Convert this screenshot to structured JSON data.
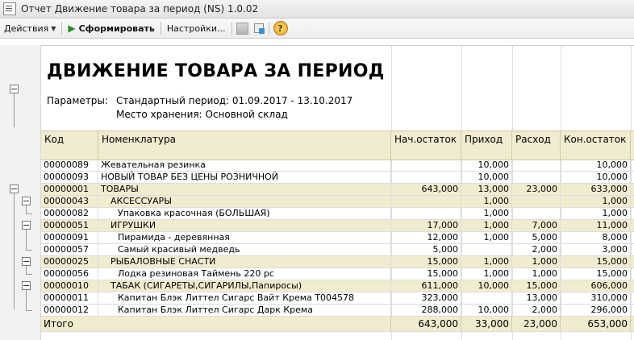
{
  "window": {
    "title": "Отчет  Движение товара за период (NS) 1.0.02"
  },
  "toolbar": {
    "actions_label": "Действия",
    "generate_label": "Сформировать",
    "settings_label": "Настройки...",
    "help_label": "?"
  },
  "report": {
    "title": "ДВИЖЕНИЕ ТОВАРА ЗА ПЕРИОД",
    "params_label": "Параметры:",
    "period": "Стандартный период: 01.09.2017 - 13.10.2017",
    "storage": "Место хранения: Основной склад",
    "columns": [
      "Код",
      "Номенклатура",
      "Нач.остаток",
      "Приход",
      "Расход",
      "Кон.остаток"
    ],
    "rows": [
      {
        "code": "00000089",
        "name": "Жевательная резинка",
        "start": "",
        "in": "10,000",
        "out": "",
        "end": "10,000",
        "group": false
      },
      {
        "code": "00000093",
        "name": "НОВЫЙ ТОВАР БЕЗ ЦЕНЫ РОЗНИЧНОЙ",
        "start": "",
        "in": "10,000",
        "out": "",
        "end": "10,000",
        "group": false
      },
      {
        "code": "00000001",
        "name": "ТОВАРЫ",
        "start": "643,000",
        "in": "13,000",
        "out": "23,000",
        "end": "633,000",
        "group": true
      },
      {
        "code": "00000043",
        "name": "АКСЕССУАРЫ",
        "start": "",
        "in": "1,000",
        "out": "",
        "end": "1,000",
        "group": true
      },
      {
        "code": "00000082",
        "name": "Упаковка красочная (БОЛЬШАЯ)",
        "start": "",
        "in": "1,000",
        "out": "",
        "end": "1,000",
        "group": false
      },
      {
        "code": "00000051",
        "name": "ИГРУШКИ",
        "start": "17,000",
        "in": "1,000",
        "out": "7,000",
        "end": "11,000",
        "group": true
      },
      {
        "code": "00000091",
        "name": "Пирамида - деревянная",
        "start": "12,000",
        "in": "1,000",
        "out": "5,000",
        "end": "8,000",
        "group": false
      },
      {
        "code": "00000057",
        "name": "Самый красивый медведь",
        "start": "5,000",
        "in": "",
        "out": "2,000",
        "end": "3,000",
        "group": false
      },
      {
        "code": "00000025",
        "name": "РЫБАЛОВНЫЕ СНАСТИ",
        "start": "15,000",
        "in": "1,000",
        "out": "1,000",
        "end": "15,000",
        "group": true
      },
      {
        "code": "00000056",
        "name": "Лодка резиновая Таймень 220 рс",
        "start": "15,000",
        "in": "1,000",
        "out": "1,000",
        "end": "15,000",
        "group": false
      },
      {
        "code": "00000010",
        "name": "ТАБАК (СИГАРЕТЫ,СИГАРИЛЫ,Папиросы)",
        "start": "611,000",
        "in": "10,000",
        "out": "15,000",
        "end": "606,000",
        "group": true
      },
      {
        "code": "00000011",
        "name": "Капитан Блэк Литтел Сигарс Вайт Крема Т004578",
        "start": "323,000",
        "in": "",
        "out": "13,000",
        "end": "310,000",
        "group": false
      },
      {
        "code": "00000012",
        "name": "Капитан Блэк Литтел Сигарс Дарк Крема",
        "start": "288,000",
        "in": "10,000",
        "out": "2,000",
        "end": "296,000",
        "group": false
      }
    ],
    "total": {
      "label": "Итого",
      "start": "643,000",
      "in": "33,000",
      "out": "23,000",
      "end": "653,000"
    }
  }
}
